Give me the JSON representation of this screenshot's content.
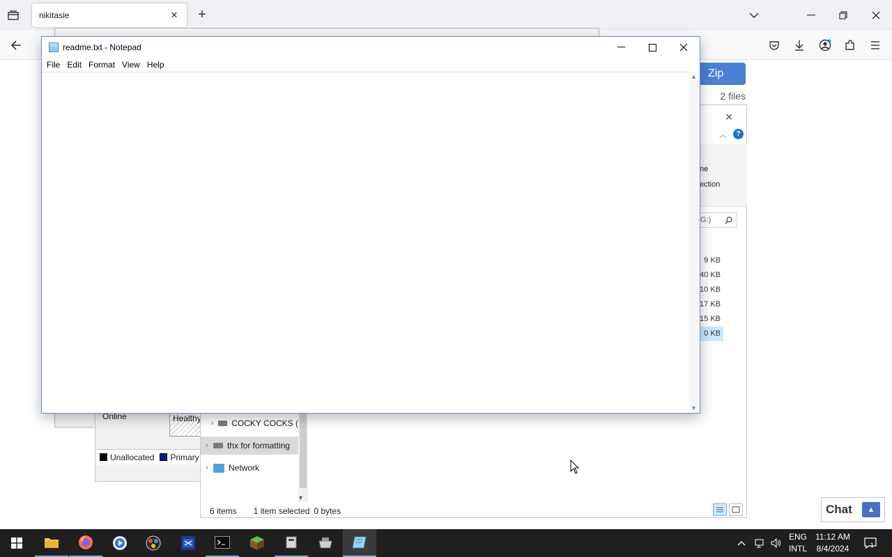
{
  "browser": {
    "tab_title": "nikitasie",
    "tab_close": "✕",
    "new_tab": "+",
    "window_controls": [
      "minimize-icon",
      "restore-icon",
      "close-icon"
    ]
  },
  "background_windows": {
    "disk_management": {
      "status": "Online",
      "partition_label": "Healthy",
      "legend": [
        {
          "label": "Unallocated",
          "color": "#000000"
        },
        {
          "label": "Primary",
          "color": "#0a1a8c"
        }
      ]
    },
    "explorer": {
      "close": "✕",
      "help": "?",
      "ribbon_items": [
        "ne",
        "ection"
      ],
      "search_text": "G:)",
      "sizes": [
        "9 KB",
        "40 KB",
        "10 KB",
        "17 KB",
        "15 KB",
        "0 KB"
      ],
      "nav_items": [
        {
          "label": "COCKY COCKS (",
          "type": "drive",
          "selected": false
        },
        {
          "label": "thx for formatting",
          "type": "drive",
          "selected": true
        },
        {
          "label": "Network",
          "type": "network",
          "selected": false
        }
      ],
      "status": {
        "items": "6 items",
        "selected": "1 item selected",
        "size": "0 bytes"
      }
    },
    "web_page": {
      "zip_button": "Zip",
      "files_count": "2 files",
      "chat_label": "Chat",
      "chat_arrow": "▲"
    }
  },
  "notepad": {
    "title": "readme.txt - Notepad",
    "menus": [
      "File",
      "Edit",
      "Format",
      "View",
      "Help"
    ],
    "content": ""
  },
  "taskbar": {
    "apps": [
      "start-icon",
      "file-explorer-icon",
      "firefox-icon",
      "media-player-icon",
      "davinci-icon",
      "visual-studio-icon",
      "terminal-icon",
      "minecraft-icon",
      "app-icon",
      "app-icon-2",
      "notepad-icon"
    ],
    "language": "ENG",
    "keyboard": "INTL",
    "time": "11:12 AM",
    "date": "8/4/2024",
    "notification_count": "1"
  }
}
